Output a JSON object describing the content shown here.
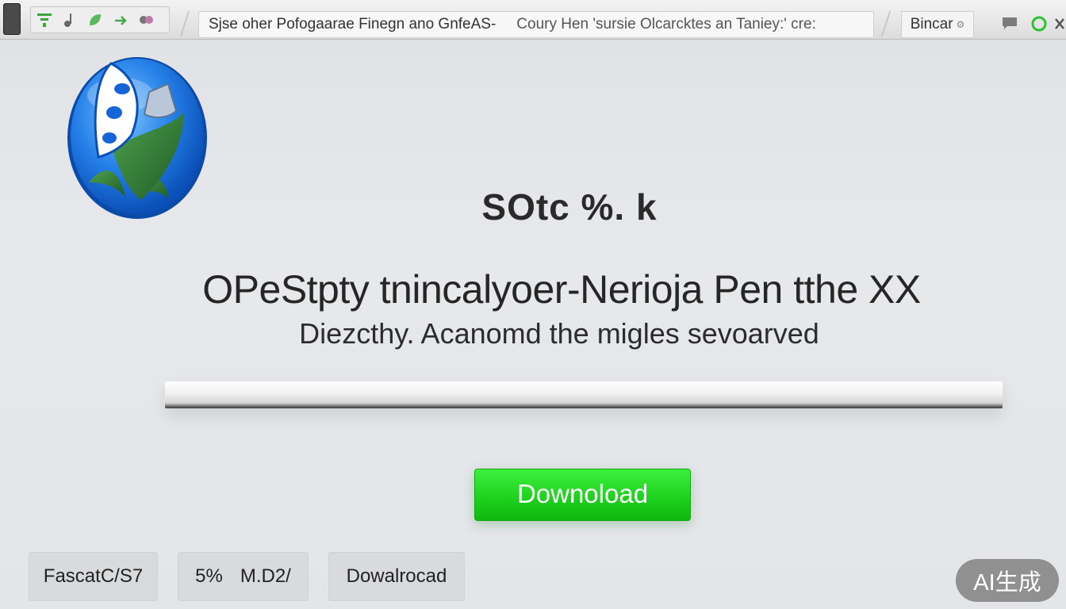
{
  "toolbar": {
    "address_text": "Sjse oher Pofogaarae Finegn ano GnfeAS-",
    "address_text_2": "Coury Hen 'sursie Olcarcktes an Taniey:' cre:",
    "right_tab_label": "Bincar",
    "icons": [
      "phone-icon",
      "filter-icon",
      "music-note-icon",
      "leaf-icon",
      "pill-icon"
    ]
  },
  "main": {
    "big_stat": "SOtc %. k",
    "headline": "OPeStpty tnincalyoer-Nerioja Pen tthe XX",
    "subline": "Diezcthy. Acanomd the migles sevoarved",
    "progress": 0.0
  },
  "download_button": {
    "label": "Downoload"
  },
  "bottom_buttons": {
    "btn1": "FascatC/S7",
    "btn2_a": "5%",
    "btn2_b": "M.D2/",
    "btn3": "Dowalrocad"
  },
  "watermark": "AI生成",
  "colors": {
    "download_green": "#1ed21e",
    "logo_blue": "#1f7fe0",
    "logo_green": "#2f7a2f"
  }
}
